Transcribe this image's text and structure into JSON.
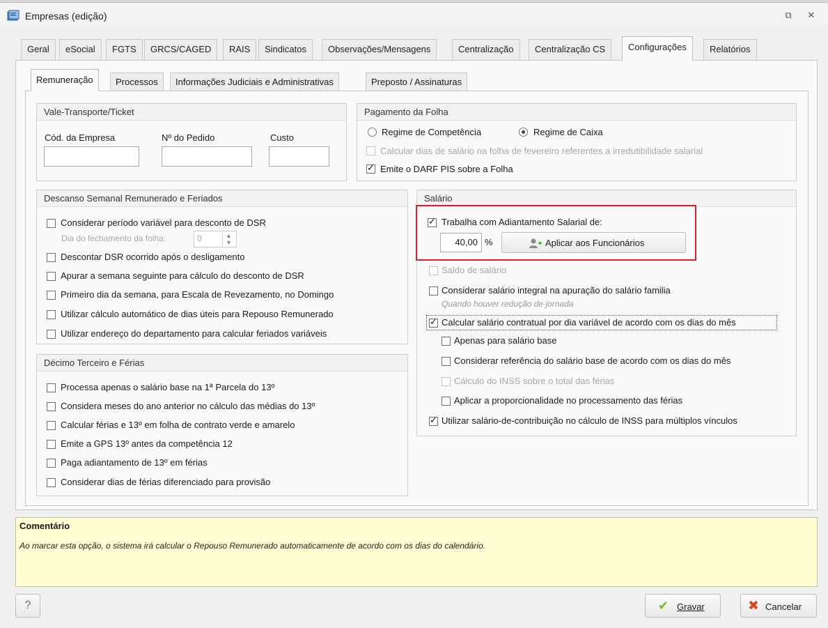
{
  "window": {
    "title": "Empresas (edição)",
    "restore_glyph": "⧉",
    "close_glyph": "✕"
  },
  "tabs": [
    {
      "label": "Geral"
    },
    {
      "label": "eSocial"
    },
    {
      "label": "FGTS"
    },
    {
      "label": "GRCS/CAGED"
    },
    {
      "label": "RAIS"
    },
    {
      "label": "Sindicatos"
    },
    {
      "label": "Observações/Mensagens"
    },
    {
      "label": "Centralização"
    },
    {
      "label": "Centralização CS"
    },
    {
      "label": "Configurações",
      "active": true
    },
    {
      "label": "Relatórios"
    }
  ],
  "subtabs": [
    {
      "label": "Remuneração",
      "active": true
    },
    {
      "label": "Processos"
    },
    {
      "label": "Informações Judiciais e Administrativas"
    },
    {
      "label": "Preposto / Assinaturas"
    }
  ],
  "vale": {
    "title": "Vale-Transporte/Ticket",
    "cod_label": "Cód. da Empresa",
    "pedido_label": "Nº do Pedido",
    "custo_label": "Custo",
    "cod_value": "",
    "pedido_value": "",
    "custo_value": ""
  },
  "pagamento": {
    "title": "Pagamento da Folha",
    "radio_competencia": "Regime de Competência",
    "radio_caixa": "Regime de Caixa",
    "selected": "caixa",
    "cb_irredutibilidade": "Calcular dias de salário na folha de fevereiro referentes a irredutibilidade salarial",
    "cb_darf": "Emite o DARF PIS sobre a Folha"
  },
  "dsr": {
    "title": "Descanso Semanal Remunerado e Feriados",
    "cb_periodo": "Considerar período variável para desconto de DSR",
    "dia_fechamento_label": "Dia do fechamento da folha:",
    "dia_fechamento_value": "0",
    "cb_descontar": "Descontar DSR ocorrido após o desligamento",
    "cb_apurar": "Apurar a semana seguinte para cálculo do desconto de DSR",
    "cb_primeiro_dia": "Primeiro dia da semana, para Escala de Revezamento, no Domingo",
    "cb_calculo_auto": "Utilizar cálculo automático de dias úteis para Repouso Remunerado",
    "cb_endereco": "Utilizar endereço do departamento para calcular feriados variáveis"
  },
  "decimo": {
    "title": "Décimo Terceiro e Férias",
    "cb_processa": "Processa apenas o salário base na 1ª Parcela do 13º",
    "cb_considera_meses": "Considera meses do ano anterior no cálculo das médias do 13º",
    "cb_calcular_ferias": "Calcular férias e 13º em folha de contrato verde e amarelo",
    "cb_emite_gps": "Emite a GPS 13º antes da competência 12",
    "cb_paga_adiantamento": "Paga adiantamento de 13º em férias",
    "cb_considerar_dias": "Considerar dias de férias diferenciado para provisão"
  },
  "salario": {
    "title": "Salário",
    "cb_adiantamento": "Trabalha com Adiantamento Salarial de:",
    "percent_value": "40,00",
    "percent_sign": "%",
    "apply_button": "Aplicar aos Funcionários",
    "cb_saldo": "Saldo de salário",
    "cb_integral": "Considerar salário integral na apuração do salário familia",
    "integral_note": "Quando houver redução de jornada",
    "cb_contratual": "Calcular salário contratual por dia variável de acordo com os dias do mês",
    "cb_apenas_base": "Apenas para salário base",
    "cb_referencia": "Considerar referência do salário base de acordo com os dias do mês",
    "cb_inss_ferias": "Cálculo do INSS sobre o total das férias",
    "cb_proporcionalidade": "Aplicar a proporcionalidade no processamento das férias",
    "cb_contribuicao": "Utilizar salário-de-contribuição no cálculo de INSS para múltiplos vínculos"
  },
  "comment": {
    "title": "Comentário",
    "text": "Ao marcar esta opção, o sistema irá calcular o Repouso Remunerado automaticamente de acordo com os dias do calendário."
  },
  "footer": {
    "help": "?",
    "gravar": "Gravar",
    "cancelar": "Cancelar"
  },
  "colors": {
    "highlight": "#d2232a",
    "comment_bg": "#ffffd3",
    "check_green": "#7cb82f",
    "cancel_red": "#d9471c"
  }
}
